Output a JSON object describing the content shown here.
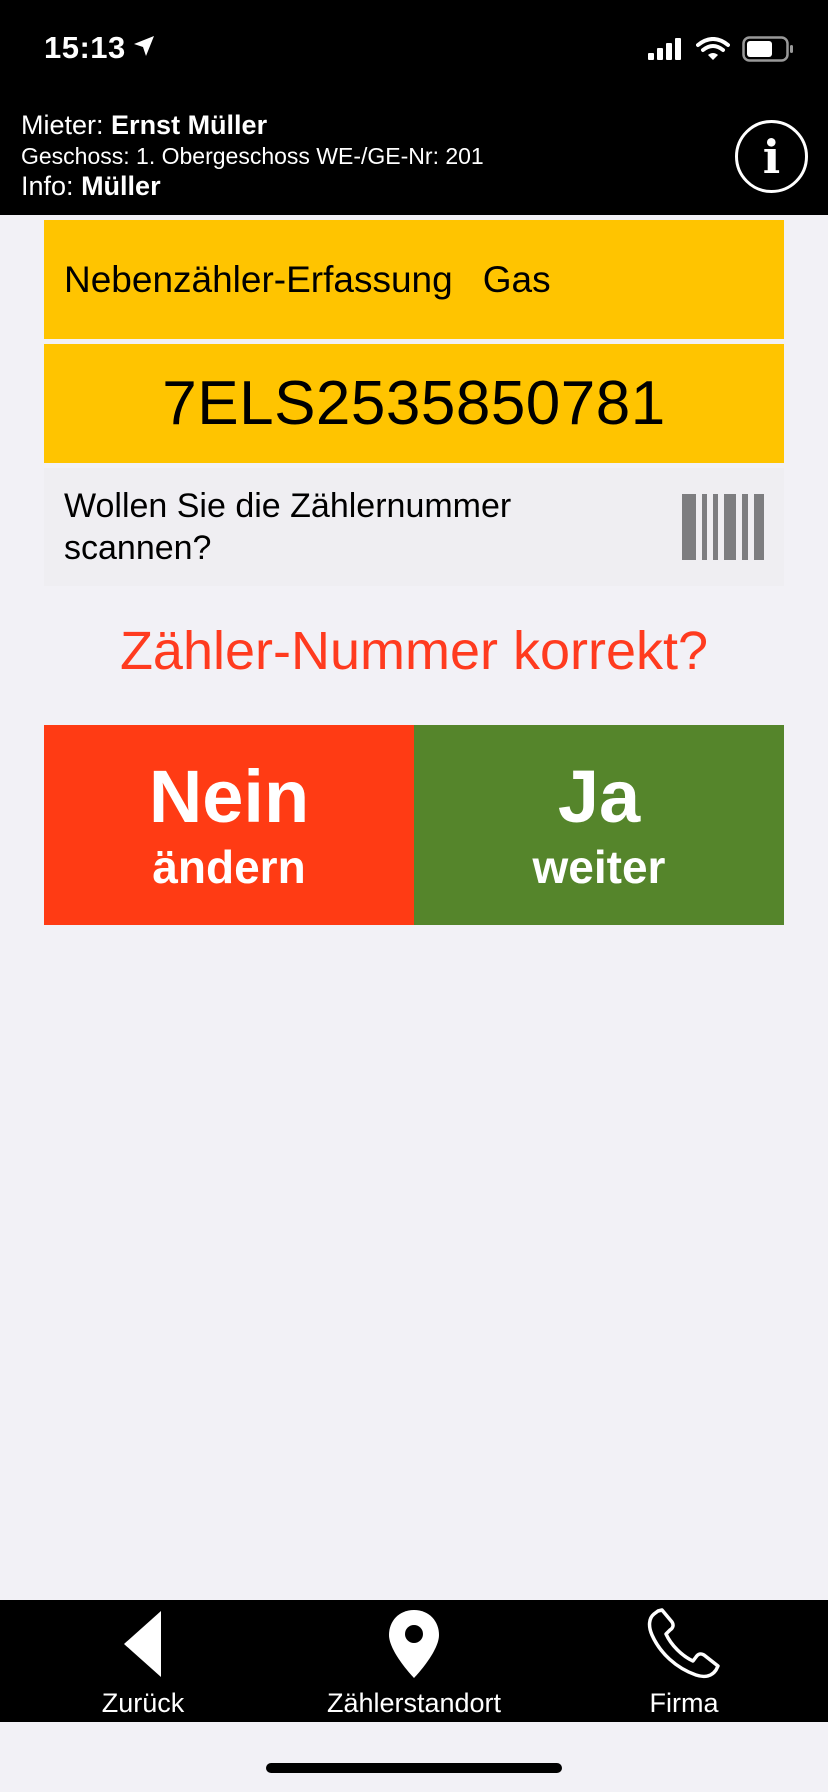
{
  "status_bar": {
    "time": "15:13",
    "icons": [
      "location-arrow-icon",
      "signal-icon",
      "wifi-icon",
      "battery-icon"
    ]
  },
  "header": {
    "tenant_label": "Mieter:",
    "tenant_name": "Ernst Müller",
    "floor_line": "Geschoss: 1. Obergeschoss WE-/GE-Nr: 201",
    "info_label": "Info:",
    "info_value": "Müller",
    "info_button_glyph": "i"
  },
  "meter": {
    "title": "Nebenzähler-Erfassung",
    "type": "Gas",
    "number": "7ELS2535850781"
  },
  "scan_prompt": {
    "text": "Wollen Sie die Zählernummer scannen?",
    "icon": "barcode-icon"
  },
  "question": "Zähler-Nummer korrekt?",
  "buttons": {
    "no": {
      "main": "Nein",
      "sub": "ändern"
    },
    "yes": {
      "main": "Ja",
      "sub": "weiter"
    }
  },
  "tabbar": [
    {
      "label": "Zurück",
      "icon": "back-triangle-icon"
    },
    {
      "label": "Zählerstandort",
      "icon": "map-pin-icon"
    },
    {
      "label": "Firma",
      "icon": "phone-icon"
    }
  ],
  "colors": {
    "header_bg": "#000000",
    "yellow": "#ffc400",
    "question_red": "#ff3b1f",
    "no_red": "#ff3b14",
    "yes_green": "#55852b",
    "page_bg": "#f2f1f6"
  }
}
